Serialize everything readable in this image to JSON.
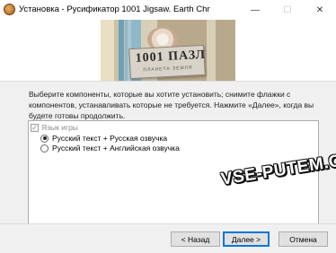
{
  "window": {
    "title": "Установка - Русификатор 1001 Jigsaw. Earth Chr",
    "minimize_glyph": "—",
    "maximize_glyph": "☐",
    "close_glyph": "✕",
    "icon": "installer-app-icon"
  },
  "banner": {
    "logo_text": "1001 ПАЗЛ",
    "logo_subtext": "ПЛАНЕТА ЗЕМЛЯ"
  },
  "main": {
    "description": "Выберите компоненты, которые вы хотите установить; снимите флажки с компонентов, устанавливать которые не требуется. Нажмите «Далее», когда вы будете готовы продолжить.",
    "components": {
      "group_label": "Язык игры",
      "group_checked": true,
      "group_disabled": true,
      "options": [
        {
          "label": "Русский текст + Русская озвучка",
          "selected": true
        },
        {
          "label": "Русский текст + Английская озвучка",
          "selected": false
        }
      ]
    }
  },
  "footer": {
    "back_label": "< Назад",
    "next_label": "Далее >",
    "cancel_label": "Отмена"
  },
  "watermark": {
    "text": "VSE-PUTEM.COM"
  }
}
